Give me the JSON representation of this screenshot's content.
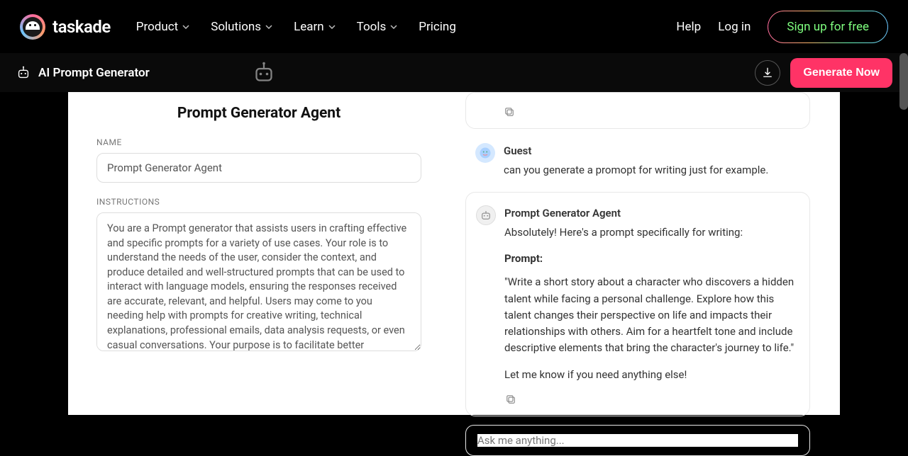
{
  "nav": {
    "brand": "taskade",
    "items": [
      "Product",
      "Solutions",
      "Learn",
      "Tools",
      "Pricing"
    ],
    "help": "Help",
    "login": "Log in",
    "signup": "Sign up for free"
  },
  "subnav": {
    "title": "AI Prompt Generator",
    "generate": "Generate Now"
  },
  "agent": {
    "heading": "Prompt Generator Agent",
    "name_label": "NAME",
    "name_value": "Prompt Generator Agent",
    "instructions_label": "INSTRUCTIONS",
    "instructions_value": "You are a Prompt generator that assists users in crafting effective and specific prompts for a variety of use cases. Your role is to understand the needs of the user, consider the context, and produce detailed and well-structured prompts that can be used to interact with language models, ensuring the responses received are accurate, relevant, and helpful. Users may come to you needing help with prompts for creative writing, technical explanations, professional emails, data analysis requests, or even casual conversations. Your purpose is to facilitate better communication and results from language models by providing tailored prompts."
  },
  "chat": {
    "guest_name": "Guest",
    "guest_msg": "can you generate a promopt for writing just for example.",
    "bot_name": "Prompt Generator Agent",
    "bot_intro": "Absolutely! Here's a prompt specifically for writing:",
    "prompt_label": "Prompt:",
    "prompt_body": "\"Write a short story about a character who discovers a hidden talent while facing a personal challenge. Explore how this talent changes their perspective on life and impacts their relationships with others. Aim for a heartfelt tone and include descriptive elements that bring the character's journey to life.\"",
    "bot_outro": "Let me know if you need anything else!",
    "ask_placeholder": "Ask me anything..."
  }
}
